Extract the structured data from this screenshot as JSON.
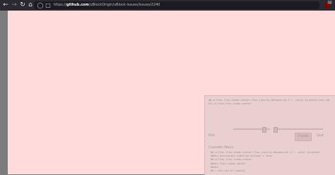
{
  "browser": {
    "url_prefix": "https://",
    "url_host": "github.com",
    "url_path": "/uBlockOrigin/uBlock-issues/issues/2240",
    "icons": [
      "back-icon",
      "forward-icon",
      "reload-icon",
      "home-icon",
      "shield-icon",
      "lock-icon"
    ],
    "ext_badge_count": "12"
  },
  "page": {
    "background_color": "#ffdcdb"
  },
  "picker": {
    "filter_text": "##.d-flex.flex-items-center.flex-justify-between.mt-3 > .color-fg-muted.text-small.d-flex.flex-items-center",
    "pick_label": "Pick",
    "create_label": "Create",
    "quit_label": "Quit",
    "section_title": "Cosmetic filters",
    "list_items": [
      "##.d-flex.flex-items-center.flex-justify-between.mt-3 > .color-fg-muted",
      "##div.discussion-timeline-actions > form",
      "##.d-flex.flex-items-center",
      "##div.flex-items-center",
      "##div",
      "## > div:nth-of-type(2)"
    ]
  }
}
